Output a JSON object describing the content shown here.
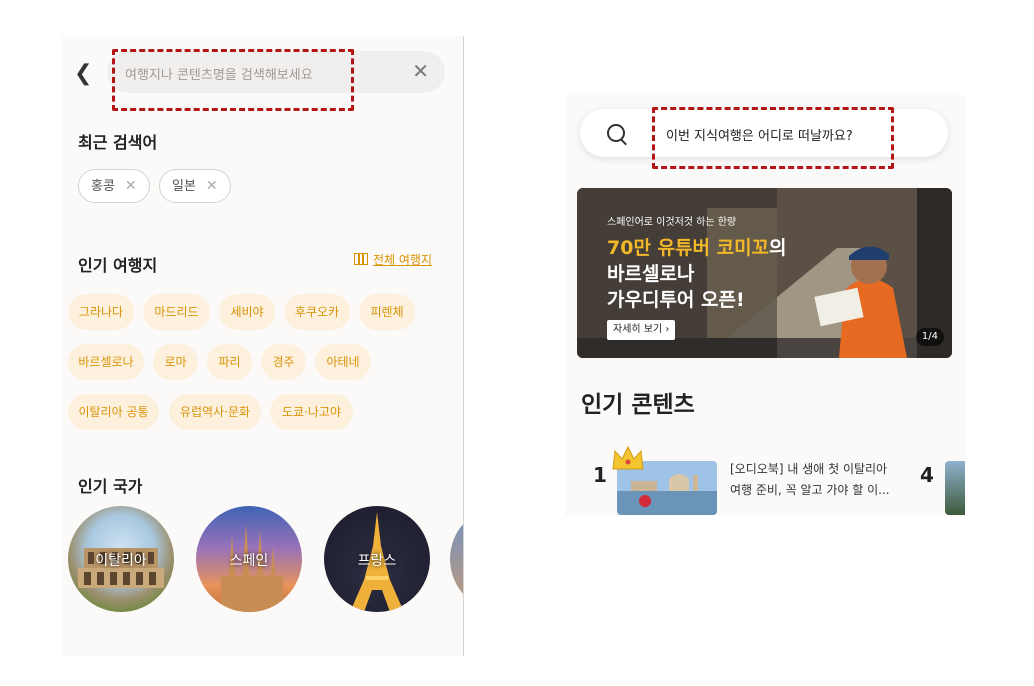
{
  "left_screen": {
    "search": {
      "placeholder": "여행지나 콘텐츠명을 검색해보세요",
      "back_icon": "back-arrow-icon",
      "clear_icon": "close-icon"
    },
    "recent": {
      "title": "최근 검색어",
      "chips": [
        {
          "label": "홍콩"
        },
        {
          "label": "일본"
        }
      ]
    },
    "popular_destinations": {
      "title": "인기 여행지",
      "see_all": "전체 여행지",
      "items": [
        {
          "label": "그라나다"
        },
        {
          "label": "마드리드"
        },
        {
          "label": "세비야"
        },
        {
          "label": "후쿠오카"
        },
        {
          "label": "피렌체"
        },
        {
          "label": "바르셀로나"
        },
        {
          "label": "로마"
        },
        {
          "label": "파리"
        },
        {
          "label": "경주"
        },
        {
          "label": "아테네"
        },
        {
          "label": "이탈리아 공통"
        },
        {
          "label": "유럽역사·문화"
        },
        {
          "label": "도쿄·나고야"
        }
      ]
    },
    "popular_countries": {
      "title": "인기 국가",
      "items": [
        {
          "label": "이탈리아"
        },
        {
          "label": "스페인"
        },
        {
          "label": "프랑스"
        }
      ]
    }
  },
  "right_screen": {
    "search": {
      "text": "이번 지식여행은 어디로 떠날까요?",
      "search_icon": "search-icon"
    },
    "banner": {
      "subtitle": "스페인어로 이것저것 하는 한량",
      "line1_highlight": "70만 유튜버 코미꼬",
      "line1_rest": "의",
      "line2": "바르셀로나",
      "line3": "가우디투어 오픈!",
      "button": "자세히 보기 ›",
      "counter": "1/4"
    },
    "popular_content": {
      "title": "인기 콘텐츠",
      "items": [
        {
          "rank": "1",
          "title": "[오디오북] 내 생애 첫 이탈리아 여행 준비, 꼭 알고 가야 할 이..."
        },
        {
          "rank": "4",
          "title": ""
        }
      ]
    }
  },
  "colors": {
    "accent": "#d9950a",
    "chip_bg": "#fdf0dd",
    "annotation": "#b31414"
  }
}
